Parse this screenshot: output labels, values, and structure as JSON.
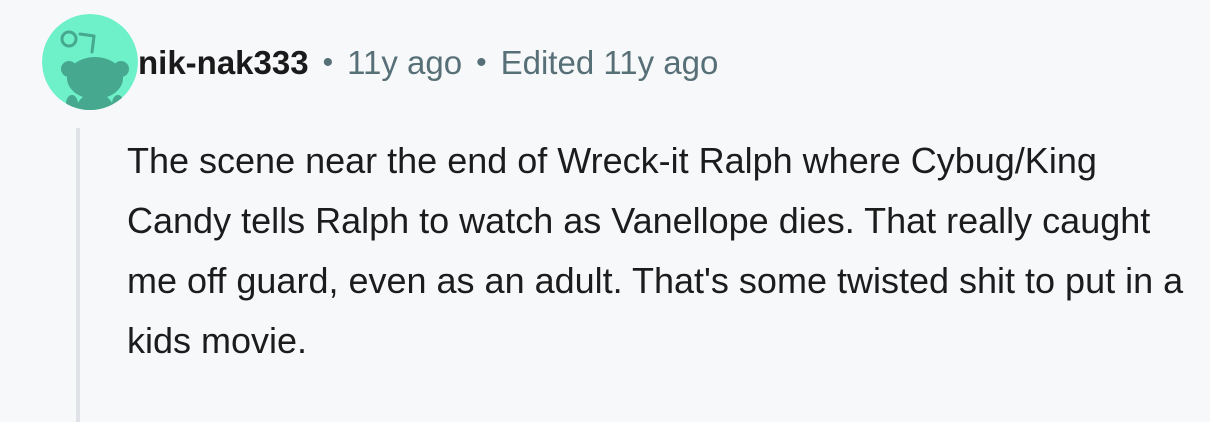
{
  "comment": {
    "author": "nik-nak333",
    "separator": "•",
    "posted": "11y ago",
    "edited": "Edited 11y ago",
    "body": "The scene near the end of Wreck-it Ralph where Cybug/King Candy tells Ralph to watch as Vanellope dies. That really caught me off guard, even as an adult. That's some twisted shit to put in a kids movie."
  },
  "avatar": {
    "icon": "snoo-avatar-icon",
    "background_color": "#6ef0c8",
    "figure_color": "#46a88e"
  }
}
